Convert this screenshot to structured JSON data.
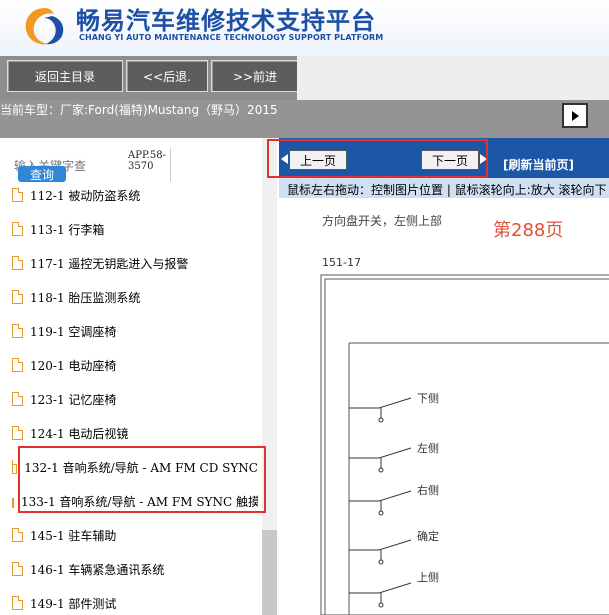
{
  "header": {
    "title_cn": "畅易汽车维修技术支持平台",
    "title_en": "CHANG YI AUTO MAINTENANCE TECHNOLOGY SUPPORT PLATFORM"
  },
  "nav": {
    "back_main": "返回主目录",
    "back": "<<后退.",
    "forward": ">>前进"
  },
  "car": {
    "text": "当前车型：厂家:Ford(福特)Mustang（野马）2015"
  },
  "sidebar": {
    "search_placeholder": "输入关键字查",
    "search_button": "查询",
    "app_code": "APP.58-3570",
    "items": [
      {
        "label": "112-1 被动防盗系统"
      },
      {
        "label": "113-1 行李箱"
      },
      {
        "label": "117-1 遥控无钥匙进入与报警"
      },
      {
        "label": "118-1 胎压监测系统"
      },
      {
        "label": "119-1 空调座椅"
      },
      {
        "label": "120-1 电动座椅"
      },
      {
        "label": "123-1 记忆座椅"
      },
      {
        "label": "124-1 电动后视镜"
      },
      {
        "label": "132-1 音响系统/导航 - AM FM CD SYNC"
      },
      {
        "label": "133-1 音响系统/导航 - AM FM SYNC 触摸"
      },
      {
        "label": "145-1 驻车辅助"
      },
      {
        "label": "146-1 车辆紧急通讯系统"
      },
      {
        "label": "149-1 部件测试"
      }
    ]
  },
  "viewer": {
    "prev": "上一页",
    "next": "下一页",
    "refresh": "[刷新当前页]",
    "hint": "鼠标左右拖动：控制图片位置 | 鼠标滚轮向上:放大  滚轮向下",
    "caption": "方向盘开关，左侧上部",
    "page": "第288页",
    "code": "151-17",
    "switches": [
      "下侧",
      "左侧",
      "右侧",
      "确定",
      "上侧"
    ]
  },
  "colors": {
    "brand_blue": "#1d4fa5",
    "toolbar_blue": "#1b57a6",
    "highlight_red": "#e03030",
    "search_blue": "#2f87d6"
  }
}
